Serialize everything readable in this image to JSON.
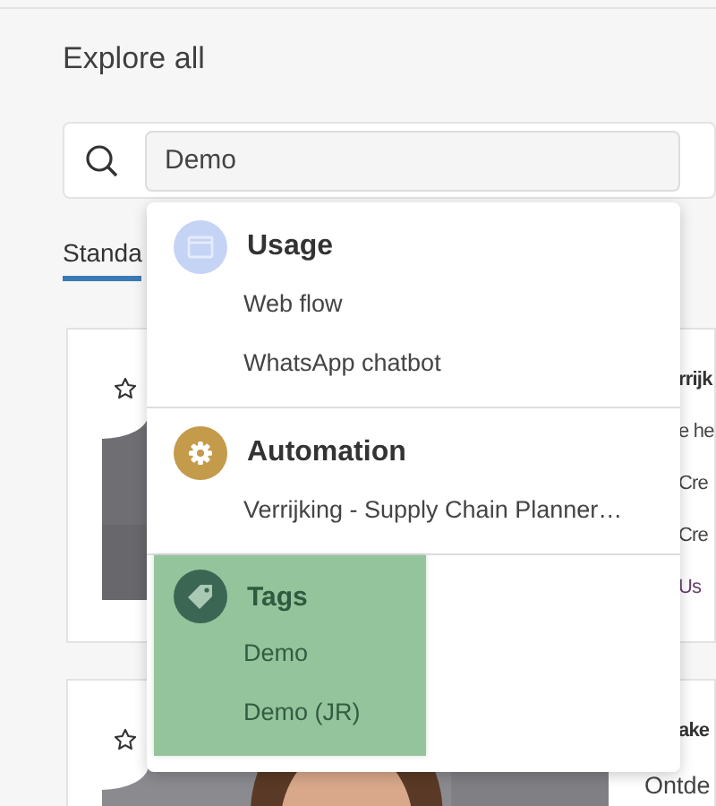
{
  "page": {
    "title": "Explore all"
  },
  "search": {
    "value": "Demo"
  },
  "tabs": [
    {
      "label": "Standa",
      "selected": true
    }
  ],
  "cards": [
    {
      "lines": [
        {
          "kind": "title",
          "text": "rrijk"
        },
        {
          "kind": "text",
          "text": "e he"
        },
        {
          "kind": "text",
          "text": "Cre"
        },
        {
          "kind": "text",
          "text": "Cre"
        },
        {
          "kind": "link",
          "text": "Us"
        }
      ]
    },
    {
      "lines": [
        {
          "kind": "title",
          "text": "ake"
        },
        {
          "kind": "text",
          "text": "Ontde"
        }
      ]
    }
  ],
  "dropdown": {
    "groups": [
      {
        "kind": "window",
        "title": "Usage",
        "color": "#c5d3f5",
        "highlighted": false,
        "items": [
          "Web flow",
          "WhatsApp chatbot"
        ]
      },
      {
        "kind": "gear",
        "title": "Automation",
        "color": "#c39b4b",
        "highlighted": false,
        "items": [
          "Verrijking - Supply Chain Planner…"
        ]
      },
      {
        "kind": "tag",
        "title": "Tags",
        "color": "#3c6654",
        "highlighted": true,
        "items": [
          "Demo",
          "Demo (JR)"
        ]
      }
    ]
  }
}
